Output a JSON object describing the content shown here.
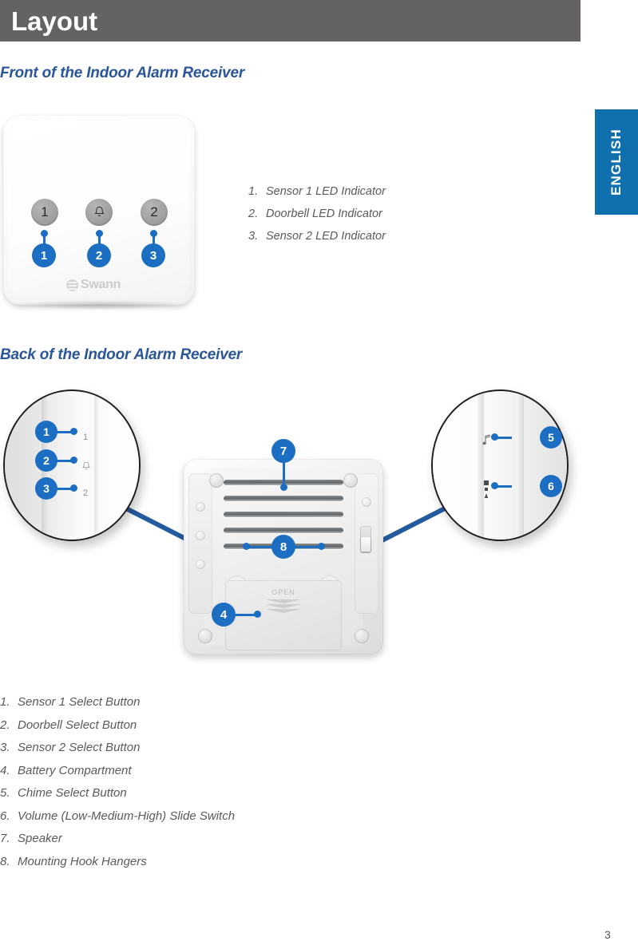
{
  "header": {
    "title": "Layout"
  },
  "language_tab": {
    "label": "ENGLISH"
  },
  "sections": {
    "front": {
      "heading": "Front of the Indoor Alarm Receiver",
      "device": {
        "brand": "Swann",
        "buttons": [
          {
            "label": "1",
            "icon": "number-1"
          },
          {
            "label": "",
            "icon": "bell-icon"
          },
          {
            "label": "2",
            "icon": "number-2"
          }
        ]
      },
      "callouts": [
        "1",
        "2",
        "3"
      ],
      "legend": [
        {
          "num": "1.",
          "text": "Sensor 1 LED Indicator"
        },
        {
          "num": "2.",
          "text": "Doorbell LED Indicator"
        },
        {
          "num": "3.",
          "text": "Sensor 2 LED Indicator"
        }
      ]
    },
    "back": {
      "heading": "Back of the Indoor Alarm Receiver",
      "magnifier_left": {
        "callouts": [
          "1",
          "2",
          "3"
        ],
        "button_labels": [
          "1",
          "bell-icon",
          "2"
        ]
      },
      "magnifier_right": {
        "callouts": [
          "5",
          "6"
        ],
        "icons": [
          "music-note-icon",
          "volume-slider-icon"
        ]
      },
      "device": {
        "battery_door_label": "OPEN",
        "callouts": [
          "7",
          "8",
          "4"
        ]
      },
      "legend": [
        {
          "num": "1.",
          "text": "Sensor 1 Select Button"
        },
        {
          "num": "2.",
          "text": "Doorbell Select Button"
        },
        {
          "num": "3.",
          "text": "Sensor 2 Select Button"
        },
        {
          "num": "4.",
          "text": "Battery Compartment"
        },
        {
          "num": "5.",
          "text": "Chime Select Button"
        },
        {
          "num": "6.",
          "text": "Volume (Low-Medium-High) Slide Switch"
        },
        {
          "num": "7.",
          "text": "Speaker"
        },
        {
          "num": "8.",
          "text": "Mounting Hook Hangers"
        }
      ]
    }
  },
  "footer": {
    "page_number": "3"
  },
  "colors": {
    "header_bar": "#656263",
    "heading_blue": "#2A5699",
    "callout_blue": "#1B6EC2",
    "tab_blue": "#1070AE",
    "connector_blue": "#245B9F"
  }
}
